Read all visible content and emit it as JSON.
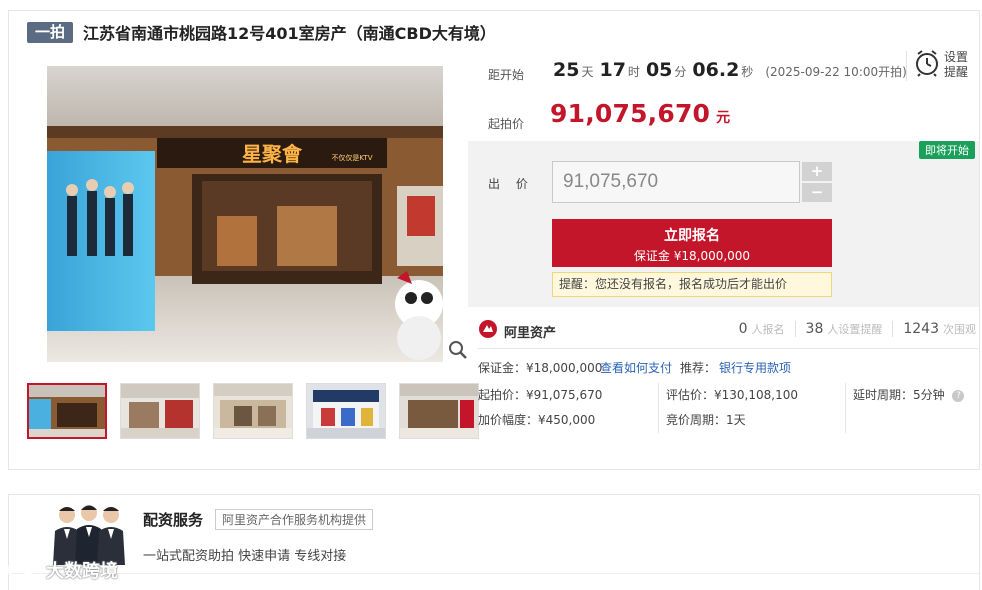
{
  "title": {
    "tag": "一拍",
    "text": "江苏省南通市桃园路12号401室房产（南通CBD大有境）"
  },
  "main_image": {
    "sign_text": "星聚會",
    "sign_sub": "不仅仅是KTV"
  },
  "countdown": {
    "label": "距开始",
    "days": "25",
    "days_unit": "天",
    "hours": "17",
    "hours_unit": "时",
    "minutes": "05",
    "minutes_unit": "分",
    "seconds": "06.2",
    "seconds_unit": "秒",
    "note": "(2025-09-22 10:00开拍)"
  },
  "alarm": {
    "label": "设置提醒"
  },
  "start_price": {
    "label": "起拍价",
    "value": "91,075,670",
    "unit": "元"
  },
  "bid": {
    "status_badge": "即将开始",
    "label": "出 价",
    "input_value": "91,075,670",
    "plus": "+",
    "minus": "−",
    "register_title": "立即报名",
    "register_sub": "保证金 ¥18,000,000",
    "reminder": "提醒：您还没有报名，报名成功后才能出价"
  },
  "platform": {
    "logo_text": "阿里资产",
    "stats": [
      {
        "num": "0",
        "unit": "人报名"
      },
      {
        "num": "38",
        "unit": "人设置提醒"
      },
      {
        "num": "1243",
        "unit": "次围观"
      }
    ]
  },
  "info": {
    "deposit": "保证金：¥18,000,000",
    "how_to_pay": "查看如何支付",
    "recommend_label": "推荐：",
    "bank_loan": "银行专用款项",
    "start_price": "起拍价：¥91,075,670",
    "appraisal": "评估价：¥130,108,100",
    "extension": "延时周期：5分钟",
    "increment": "加价幅度：¥450,000",
    "cycle": "竞价周期：1天"
  },
  "finance": {
    "title": "配资服务",
    "provider": "阿里资产合作服务机构提供",
    "desc": "一站式配资助拍 快速申请 专线对接"
  },
  "watermark": {
    "text": "大数跨境"
  },
  "colors": {
    "accent": "#c4162a",
    "badge_green": "#1aa05a",
    "link_blue": "#2b64b3",
    "tag_bg": "#5a6b82"
  }
}
